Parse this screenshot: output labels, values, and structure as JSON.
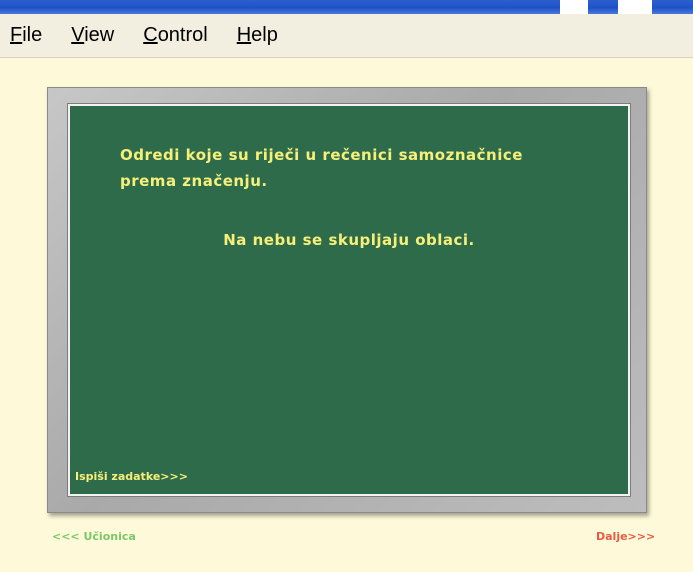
{
  "menu": {
    "items": [
      {
        "mnemonic": "F",
        "rest": "ile"
      },
      {
        "mnemonic": "V",
        "rest": "iew"
      },
      {
        "mnemonic": "C",
        "rest": "ontrol"
      },
      {
        "mnemonic": "H",
        "rest": "elp"
      }
    ]
  },
  "board": {
    "instruction": "Odredi koje su riječi u rečenici samoznačnice prema značenju.",
    "sentence": "Na nebu se skupljaju oblaci.",
    "print_tasks_label": "Ispiši zadatke>>>"
  },
  "nav": {
    "back_label": "<<< Učionica",
    "next_label": "Dalje>>>"
  },
  "colors": {
    "background": "#fdf9d9",
    "chalkboard": "#2e6b4b",
    "chalk_text": "#f6f07a",
    "back_link": "#7bc86b",
    "next_link": "#e65b45",
    "title_bar": "#1f52c7"
  }
}
